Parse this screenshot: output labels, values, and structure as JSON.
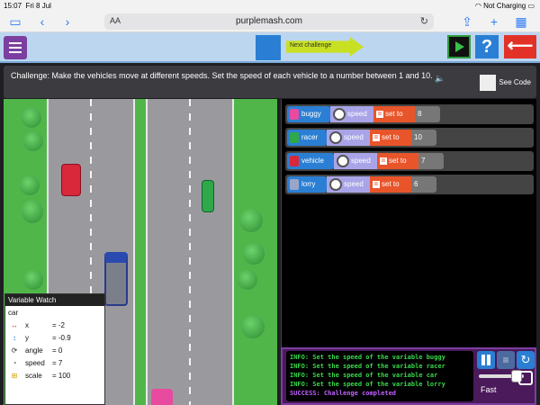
{
  "status_bar": {
    "time": "15:07",
    "date": "Fri 8 Jul",
    "battery": "Not Charging"
  },
  "browser": {
    "url": "purplemash.com",
    "text_size": "AA"
  },
  "toolbar": {
    "next_challenge": "Next challenge",
    "help": "?"
  },
  "challenge": {
    "text": "Challenge: Make the vehicles move at different speeds. Set the speed of each vehicle to a number between 1 and 10.",
    "see_code": "See Code"
  },
  "code_rows": [
    {
      "object": "buggy",
      "property": "speed",
      "action": "set to",
      "value": "8",
      "color": "#e84aa0"
    },
    {
      "object": "racer",
      "property": "speed",
      "action": "set to",
      "value": "10",
      "color": "#2fa84a"
    },
    {
      "object": "vehicle",
      "property": "speed",
      "action": "set to",
      "value": "7",
      "color": "#d8283a"
    },
    {
      "object": "lorry",
      "property": "speed",
      "action": "set to",
      "value": "6",
      "color": "#9aa6c8"
    }
  ],
  "variable_watch": {
    "title": "Variable Watch",
    "object": "car",
    "vars": [
      {
        "name": "x",
        "value": "= -2",
        "icon": "horizontal-arrow-icon"
      },
      {
        "name": "y",
        "value": "= -0.9",
        "icon": "vertical-arrow-icon"
      },
      {
        "name": "angle",
        "value": "= 0",
        "icon": "angle-icon"
      },
      {
        "name": "speed",
        "value": "= 7",
        "icon": "speedometer-icon"
      },
      {
        "name": "scale",
        "value": "= 100",
        "icon": "scale-icon"
      }
    ]
  },
  "console": {
    "lines": [
      "INFO: Set the speed of the variable buggy",
      "INFO: Set the speed of the variable racer",
      "INFO: Set the speed of the variable car",
      "INFO: Set the speed of the variable lorry"
    ],
    "success": "SUCCESS: Challenge completed"
  },
  "controls": {
    "speed_label": "Fast",
    "speed_level": 0.9
  }
}
